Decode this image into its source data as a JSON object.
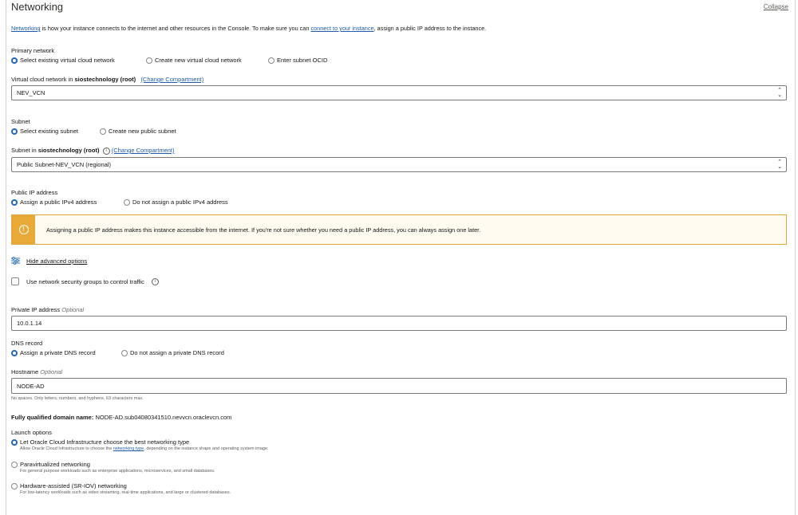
{
  "section": {
    "title": "Networking",
    "collapse_label": "Collapse"
  },
  "intro": {
    "link1": "Networking",
    "text1": " is how your instance connects to the internet and other resources in the Console. To make sure you can ",
    "link2": "connect to your instance",
    "text2": ", assign a public IP address to the instance."
  },
  "primary_network": {
    "label": "Primary network",
    "options": [
      "Select existing virtual cloud network",
      "Create new virtual cloud network",
      "Enter subnet OCID"
    ],
    "selected": "Select existing virtual cloud network"
  },
  "vcn": {
    "label_prefix": "Virtual cloud network in ",
    "compartment": "siostechnology (root)",
    "change_link": "(Change Compartment)",
    "value": "NEV_VCN"
  },
  "subnet": {
    "label": "Subnet",
    "options": [
      "Select existing subnet",
      "Create new public subnet"
    ],
    "selected": "Select existing subnet",
    "select_label_prefix": "Subnet in ",
    "compartment": "siostechnology (root)",
    "info_glyph": "i",
    "change_link": "(Change Compartment)",
    "value": "Public Subnet-NEV_VCN (regional)"
  },
  "public_ip": {
    "label": "Public IP address",
    "options": [
      "Assign a public IPv4 address",
      "Do not assign a public IPv4 address"
    ],
    "selected": "Assign a public IPv4 address"
  },
  "warning": {
    "icon": "!",
    "text": "Assigning a public IP address makes this instance accessible from the internet. If you're not sure whether you need a public IP address, you can always assign one later."
  },
  "advanced": {
    "toggle_label": "Hide advanced options"
  },
  "nsg": {
    "checkbox_label": "Use network security groups to control traffic",
    "checked": false
  },
  "private_ip": {
    "label": "Private IP address",
    "optional": "Optional",
    "value": "10.0.1.14"
  },
  "dns": {
    "label": "DNS record",
    "options": [
      "Assign a private DNS record",
      "Do not assign a private DNS record"
    ],
    "selected": "Assign a private DNS record"
  },
  "hostname": {
    "label": "Hostname",
    "optional": "Optional",
    "value": "NODE-AD",
    "help": "No spaces. Only letters, numbers, and hyphens. 63 characters max."
  },
  "fqdn": {
    "label": "Fully qualified domain name:",
    "value": " NODE-AD.sub04080341510.nevvcn.oraclevcn.com"
  },
  "launch": {
    "label": "Launch options",
    "options": [
      {
        "title": "Let Oracle Cloud Infrastructure choose the best networking type",
        "desc_before": "Allow Oracle Cloud Infrastructure to choose the ",
        "desc_link": "networking type",
        "desc_after": ", depending on the instance shape and operating system image."
      },
      {
        "title": "Paravirtualized networking",
        "desc": "For general purpose workloads such as enterprise applications, microservices, and small databases."
      },
      {
        "title": "Hardware-assisted (SR-IOV) networking",
        "desc": "For low-latency workloads such as video streaming, real-time applications, and large or clustered databases."
      }
    ],
    "selected": "Let Oracle Cloud Infrastructure choose the best networking type"
  },
  "colors": {
    "accent": "#2168b7",
    "link": "#1f5ba8",
    "warning": "#e9a936"
  }
}
